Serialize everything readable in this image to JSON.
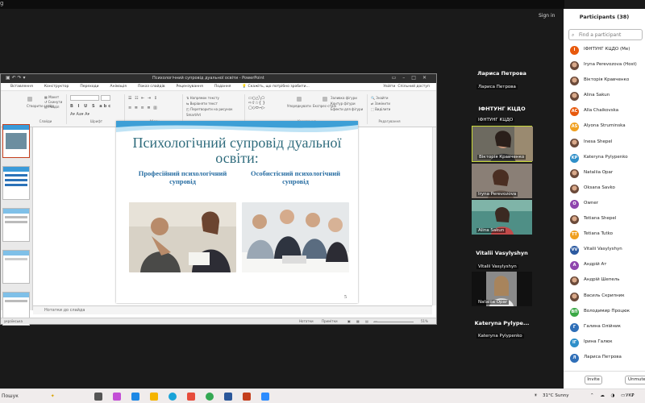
{
  "zoom": {
    "corner": "g",
    "signin": "Sign in"
  },
  "ppt": {
    "title": "Психологічний супровід дуальної освіти - PowerPoint",
    "menu": [
      "Вставлення",
      "Конструктор",
      "Переходи",
      "Анімація",
      "Показ слайдів",
      "Рецензування",
      "Подання"
    ],
    "search_hint": "Скажіть, що потрібно зробити...",
    "user": "Увійти",
    "share": "Спільний доступ",
    "ribbon_labels": [
      "Слайди",
      "Шрифт",
      "Абзац",
      "Креслення",
      "Редагування"
    ],
    "ribbon_buttons": [
      "Макет",
      "Скинути",
      "Розділ",
      "Напрямок тексту",
      "Вирівняти текст",
      "Перетворити на рисунок SmartArt",
      "Упорядкувати",
      "Експрес-стилі",
      "Заливка фігури",
      "Контур фігури",
      "Ефекти для фігури",
      "Знайти",
      "Замінити",
      "Виділити",
      "Створити слайд"
    ],
    "notes": "Нотатки до слайда",
    "status_left": "українська",
    "status_notes": "Нотатки",
    "status_comments": "Примітки",
    "zoom_pct": "51%"
  },
  "slide": {
    "title": "Психологічний супровід дуальної освіти:",
    "sub_left": "Професійний психологічний супровід",
    "sub_right": "Особистісний психологічний супровід",
    "page": "5"
  },
  "tiles": [
    {
      "big": "Лариса Петрова",
      "name": "Лариса Петрова"
    },
    {
      "big": "ІФНТУНГ КЦДО",
      "name": "ІФНТУНГ КЦДО"
    },
    {
      "name": "Вікторія Кравченко"
    },
    {
      "name": "Iryna Perevozova"
    },
    {
      "name": "Alina Sakun"
    },
    {
      "big": "Vitalii Vasylyshyn",
      "name": "Vitalii Vasylyshyn"
    },
    {
      "name": "Nataliia Opar"
    },
    {
      "big": "Kateryna Pylype...",
      "name": "Kateryna Pylypenko"
    }
  ],
  "participants": {
    "title": "Participants (38)",
    "search_placeholder": "Find a participant",
    "list": [
      {
        "initials": "I",
        "name": "ІФНТУНГ КЦДО (Me)",
        "color": "#e8590c"
      },
      {
        "initials": "",
        "name": "Iryna Perevozova (Host)",
        "color": ""
      },
      {
        "initials": "",
        "name": "Вікторія Кравченко",
        "color": ""
      },
      {
        "initials": "",
        "name": "Alina Sakun",
        "color": ""
      },
      {
        "initials": "AC",
        "name": "Alla Chaikovska",
        "color": "#e8590c"
      },
      {
        "initials": "AS",
        "name": "Alyona Struminska",
        "color": "#f0a020"
      },
      {
        "initials": "",
        "name": "Inesa Shepel",
        "color": ""
      },
      {
        "initials": "KP",
        "name": "Kateryna Pylypenko",
        "color": "#2f8fc9"
      },
      {
        "initials": "",
        "name": "Nataliia Opar",
        "color": ""
      },
      {
        "initials": "",
        "name": "Oksana Savko",
        "color": ""
      },
      {
        "initials": "O",
        "name": "Owner",
        "color": "#8e44ad"
      },
      {
        "initials": "",
        "name": "Tetiana Shepel",
        "color": ""
      },
      {
        "initials": "TT",
        "name": "Tetiana Tutko",
        "color": "#f0a020"
      },
      {
        "initials": "VV",
        "name": "Vitalii Vasylyshyn",
        "color": "#2c5aa0"
      },
      {
        "initials": "А",
        "name": "Андрій Ат",
        "color": "#8e44ad"
      },
      {
        "initials": "",
        "name": "Андрій Шепель",
        "color": ""
      },
      {
        "initials": "",
        "name": "Василь Скрипник",
        "color": ""
      },
      {
        "initials": "ВП",
        "name": "Володимир Процюк",
        "color": "#3aa845"
      },
      {
        "initials": "Г",
        "name": "Галина Олійник",
        "color": "#2f6fb8"
      },
      {
        "initials": "ІГ",
        "name": "Ірина Галюк",
        "color": "#2f8fc9"
      },
      {
        "initials": "Л",
        "name": "Лариса Петрова",
        "color": "#2f6fb8"
      }
    ],
    "invite": "Invite",
    "unmute": "Unmute"
  },
  "taskbar": {
    "search": "Пошук",
    "weather": "31°C  Sunny",
    "lang": "УКР"
  }
}
